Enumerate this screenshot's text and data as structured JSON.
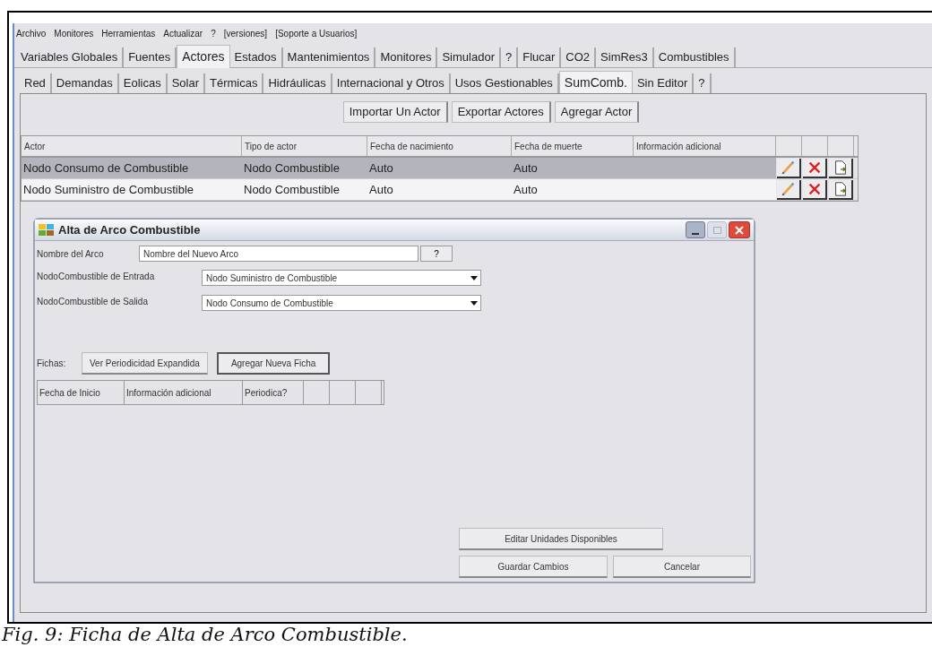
{
  "menu": [
    "Archivo",
    "Monitores",
    "Herramientas",
    "Actualizar",
    "?",
    "[versiones]",
    "[Soporte a Usuarios]"
  ],
  "tabs": [
    {
      "label": "Variables Globales",
      "selected": false
    },
    {
      "label": "Fuentes",
      "selected": false
    },
    {
      "label": "Actores",
      "selected": true
    },
    {
      "label": "Estados",
      "selected": false
    },
    {
      "label": "Mantenimientos",
      "selected": false
    },
    {
      "label": "Monitores",
      "selected": false
    },
    {
      "label": "Simulador",
      "selected": false
    },
    {
      "label": "?",
      "selected": false
    },
    {
      "label": "Flucar",
      "selected": false
    },
    {
      "label": "CO2",
      "selected": false
    },
    {
      "label": "SimRes3",
      "selected": false
    },
    {
      "label": "Combustibles",
      "selected": false
    }
  ],
  "subtabs": [
    {
      "label": "Red",
      "selected": false
    },
    {
      "label": "Demandas",
      "selected": false
    },
    {
      "label": "Eolicas",
      "selected": false
    },
    {
      "label": "Solar",
      "selected": false
    },
    {
      "label": "Térmicas",
      "selected": false
    },
    {
      "label": "Hidráulicas",
      "selected": false
    },
    {
      "label": "Internacional y Otros",
      "selected": false
    },
    {
      "label": "Usos Gestionables",
      "selected": false
    },
    {
      "label": "SumComb.",
      "selected": true
    },
    {
      "label": "Sin Editor",
      "selected": false
    },
    {
      "label": "?",
      "selected": false
    }
  ],
  "actions": [
    "Importar Un Actor",
    "Exportar Actores",
    "Agregar Actor"
  ],
  "table": {
    "columns": [
      "Actor",
      "Tipo de actor",
      "Fecha de nacimiento",
      "Fecha de muerte",
      "Información adicional"
    ],
    "rows": [
      {
        "cells": [
          "Nodo Consumo de Combustible",
          "Nodo Combustible",
          "Auto",
          "Auto",
          ""
        ],
        "selected": true
      },
      {
        "cells": [
          "Nodo Suministro de Combustible",
          "Nodo Combustible",
          "Auto",
          "Auto",
          ""
        ],
        "selected": false
      }
    ]
  },
  "dialog": {
    "title": "Alta de Arco Combustible",
    "name_label": "Nombre del Arco",
    "name_value": "Nombre del Nuevo Arco",
    "help": "?",
    "selects": [
      {
        "label": "NodoCombustible de Entrada",
        "value": "Nodo Suministro de Combustible"
      },
      {
        "label": "NodoCombustible de Salida",
        "value": "Nodo Consumo de Combustible"
      }
    ],
    "fichas_label": "Fichas:",
    "fichas_buttons": [
      {
        "label": "Ver Periodicidad Expandida",
        "default": false
      },
      {
        "label": "Agregar Nueva Ficha",
        "default": true
      }
    ],
    "fichas_columns": [
      "Fecha de Inicio",
      "Información adicional",
      "Periodica?"
    ],
    "edit_button": "Editar Unidades Disponibles",
    "save_button": "Guardar Cambios",
    "cancel_button": "Cancelar"
  },
  "caption": "Fig. 9: Ficha de Alta de Arco Combustible."
}
